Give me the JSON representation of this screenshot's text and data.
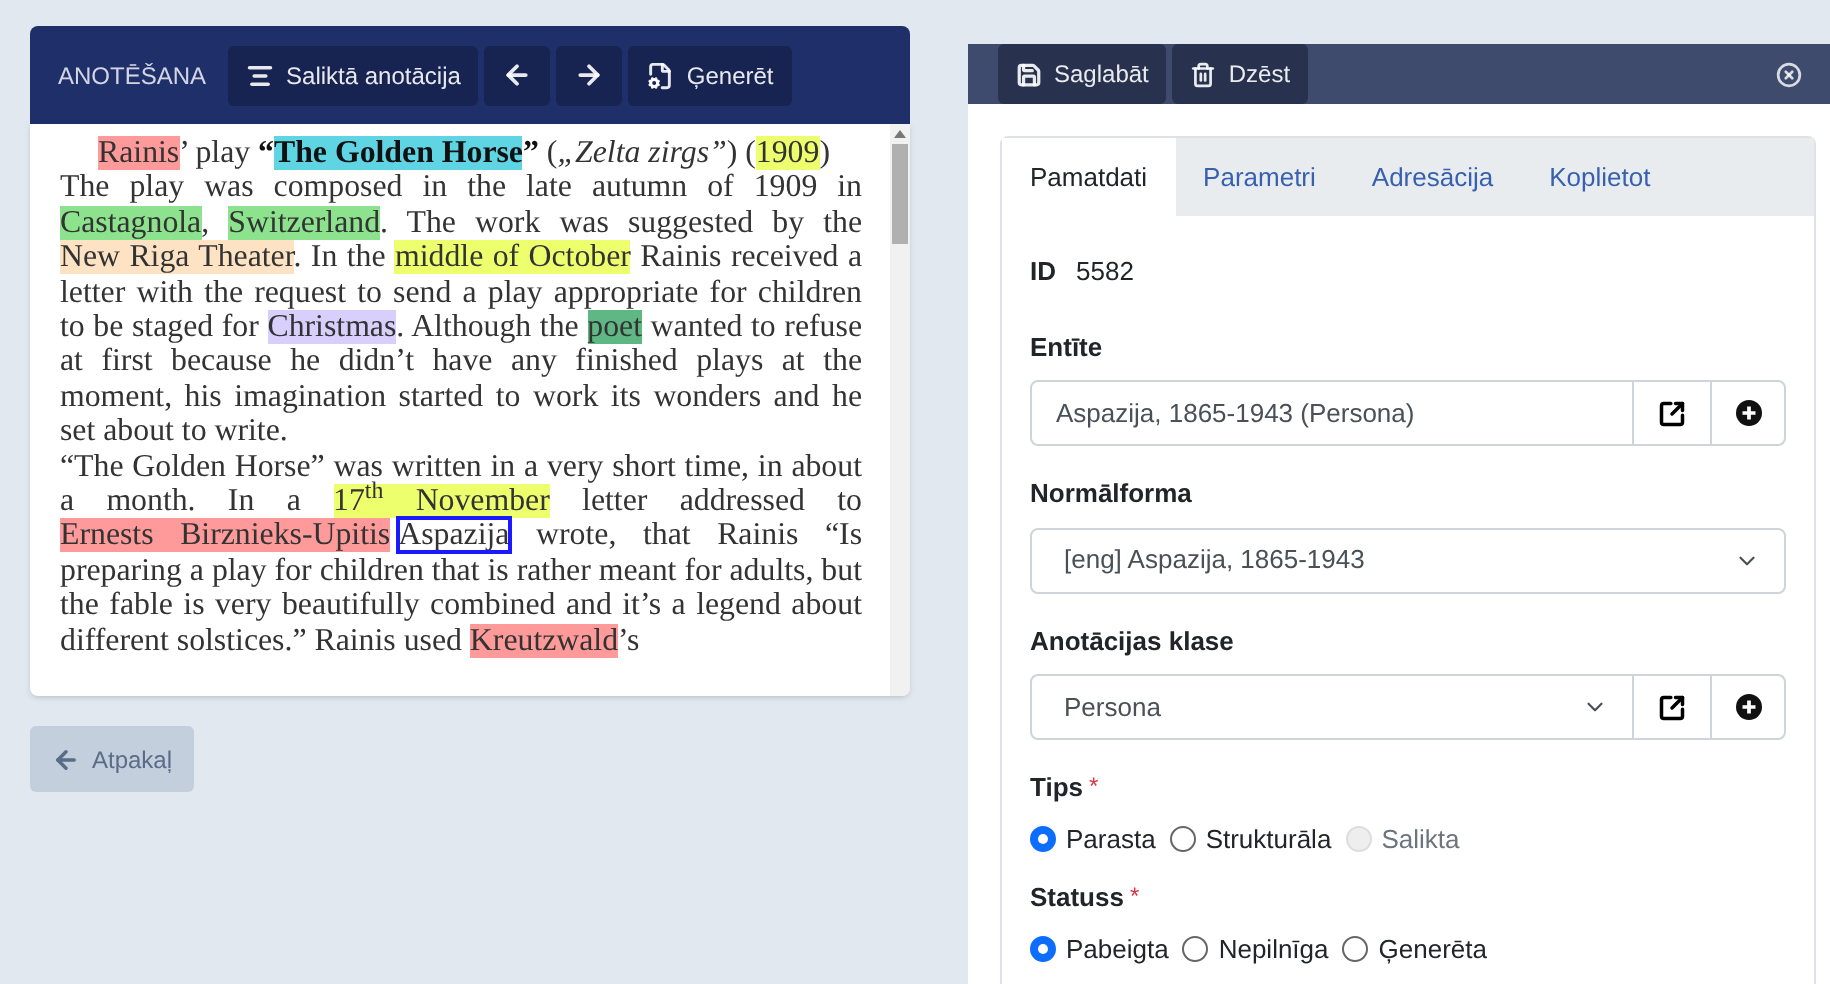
{
  "annotation_panel": {
    "title": "ANOTĒŠANA",
    "toolbar": [
      {
        "kind": "compound",
        "label": "Saliktā anotācija"
      },
      {
        "kind": "prev"
      },
      {
        "kind": "next"
      },
      {
        "kind": "generate",
        "label": "Ģenerēt"
      }
    ],
    "paragraphs": [
      {
        "kind": "lead",
        "segments": [
          {
            "kind": "annotation",
            "text": "Rainis",
            "color": "#ff9a9a",
            "selected": false
          },
          {
            "kind": "text",
            "text": "’ play "
          },
          {
            "kind": "text",
            "text": "“",
            "bold": true
          },
          {
            "kind": "annotation",
            "text": "The Golden Horse",
            "color": "#5fd4e3",
            "bold": true,
            "selected": false
          },
          {
            "kind": "text",
            "text": "”",
            "bold": true
          },
          {
            "kind": "text",
            "text": " ("
          },
          {
            "kind": "text",
            "text": "„Zelta zirgs”",
            "italic": true
          },
          {
            "kind": "text",
            "text": ") ("
          },
          {
            "kind": "annotation",
            "text": "1909",
            "color": "#eeff6e",
            "selected": false
          },
          {
            "kind": "text",
            "text": ")"
          }
        ]
      },
      {
        "kind": "body",
        "segments": [
          {
            "kind": "text",
            "text": "The play was composed in the late autumn of 1909 in "
          },
          {
            "kind": "annotation",
            "text": "Castagnola",
            "color": "#8de38d",
            "selected": false
          },
          {
            "kind": "text",
            "text": ", "
          },
          {
            "kind": "annotation",
            "text": "Switzerland",
            "color": "#8de38d",
            "selected": false
          },
          {
            "kind": "text",
            "text": ". The work was suggested by the "
          },
          {
            "kind": "annotation",
            "text": "New Riga Theater",
            "color": "#fde3c3",
            "selected": false
          },
          {
            "kind": "text",
            "text": ". In the "
          },
          {
            "kind": "annotation",
            "text": "middle of October",
            "color": "#eeff6e",
            "selected": false
          },
          {
            "kind": "text",
            "text": " Rainis received a letter with the request to send a play appropriate for children to be staged for "
          },
          {
            "kind": "annotation",
            "text": "Christmas",
            "color": "#d9cffc",
            "selected": false
          },
          {
            "kind": "text",
            "text": ". Although the "
          },
          {
            "kind": "annotation",
            "text": "poet",
            "color": "#5fb784",
            "selected": false
          },
          {
            "kind": "text",
            "text": " wanted to refuse at first because he didn’t have any finished plays at the moment, his imagination started to work its wonders and he set about to write."
          }
        ]
      },
      {
        "kind": "body",
        "segments": [
          {
            "kind": "text",
            "text": "“The Golden Horse” was written in a very short time, in about a month. In a "
          },
          {
            "kind": "annotation",
            "text": "17$^{th}$ November",
            "color": "#eeff6e",
            "selected": false
          },
          {
            "kind": "text",
            "text": " letter addressed to "
          },
          {
            "kind": "annotation",
            "text": "Ernests Birznieks-Upitis",
            "color": "#ff9a9a",
            "selected": false
          },
          {
            "kind": "annotation",
            "text": "Aspazija",
            "selected": true
          },
          {
            "kind": "text",
            "text": " wrote, that Rainis “Is preparing a play for children that is rather meant for adults, but the fable is very beautifully combined and it’s a legend about different solstices.” Rainis used "
          },
          {
            "kind": "annotation",
            "text": "Kreutzwald",
            "color": "#ff9a9a",
            "selected": false
          },
          {
            "kind": "text",
            "text": "’s"
          }
        ]
      }
    ],
    "back_button": {
      "label": "Atpakaļ"
    }
  },
  "detail_panel": {
    "buttons": [
      {
        "kind": "save",
        "label": "Saglabāt"
      },
      {
        "kind": "delete",
        "label": "Dzēst"
      }
    ],
    "tabs": [
      {
        "label": "Pamatdati",
        "selected": true
      },
      {
        "label": "Parametri",
        "selected": false
      },
      {
        "label": "Adresācija",
        "selected": false
      },
      {
        "label": "Koplietot",
        "selected": false
      }
    ],
    "id_label": "ID",
    "id_value": "5582",
    "fields": [
      {
        "kind": "input_actions",
        "label": "Entīte",
        "value": "Aspazija, 1865-1943 (Persona)"
      },
      {
        "kind": "select",
        "label": "Normālforma",
        "value": "[eng] Aspazija, 1865-1943"
      },
      {
        "kind": "select_actions",
        "label": "Anotācijas klase",
        "value": "Persona"
      }
    ],
    "radio_groups": [
      {
        "label": "Tips",
        "required_mark": "*",
        "options": [
          {
            "label": "Parasta",
            "selected": true,
            "disabled": false
          },
          {
            "label": "Strukturāla",
            "selected": false,
            "disabled": false
          },
          {
            "label": "Salikta",
            "selected": false,
            "disabled": true
          }
        ]
      },
      {
        "label": "Statuss",
        "required_mark": "*",
        "options": [
          {
            "label": "Pabeigta",
            "selected": true,
            "disabled": false
          },
          {
            "label": "Nepilnīga",
            "selected": false,
            "disabled": false
          },
          {
            "label": "Ģenerēta",
            "selected": false,
            "disabled": false
          }
        ]
      }
    ]
  }
}
